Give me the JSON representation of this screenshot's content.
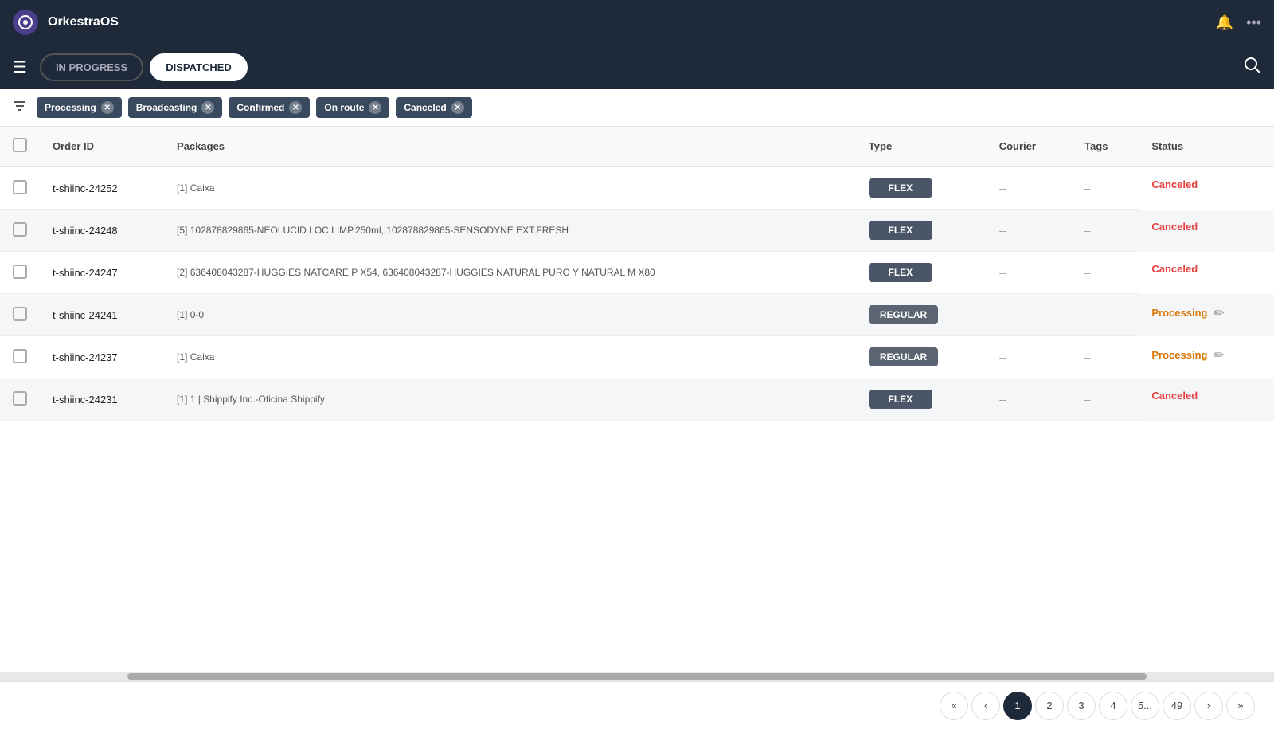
{
  "app": {
    "title": "OrkestraOS",
    "logo_letter": "O"
  },
  "header": {
    "bell_icon": "🔔",
    "more_icon": "···"
  },
  "toolbar": {
    "tab_in_progress": "IN PROGRESS",
    "tab_dispatched": "DISPATCHED",
    "active_tab": "dispatched"
  },
  "filters": {
    "items": [
      {
        "label": "Processing"
      },
      {
        "label": "Broadcasting"
      },
      {
        "label": "Confirmed"
      },
      {
        "label": "On route"
      },
      {
        "label": "Canceled"
      }
    ]
  },
  "table": {
    "columns": [
      "Order ID",
      "Packages",
      "Type",
      "Courier",
      "Tags",
      "Status"
    ],
    "rows": [
      {
        "id": "t-shiinc-24252",
        "packages": "[1] Caixa",
        "type": "FLEX",
        "type_class": "flex",
        "courier": "--",
        "tags": "–",
        "status": "Canceled",
        "status_class": "canceled"
      },
      {
        "id": "t-shiinc-24248",
        "packages": "[5] 102878829865-NEOLUCID LOC.LIMP.250ml, 102878829865-SENSODYNE EXT.FRESH",
        "type": "FLEX",
        "type_class": "flex",
        "courier": "--",
        "tags": "–",
        "status": "Canceled",
        "status_class": "canceled"
      },
      {
        "id": "t-shiinc-24247",
        "packages": "[2] 636408043287-HUGGIES NATCARE P X54, 636408043287-HUGGIES NATURAL PURO Y NATURAL M X80",
        "type": "FLEX",
        "type_class": "flex",
        "courier": "--",
        "tags": "–",
        "status": "Canceled",
        "status_class": "canceled"
      },
      {
        "id": "t-shiinc-24241",
        "packages": "[1] 0-0",
        "type": "REGULAR",
        "type_class": "regular",
        "courier": "--",
        "tags": "–",
        "status": "Processing",
        "status_class": "processing"
      },
      {
        "id": "t-shiinc-24237",
        "packages": "[1] Caixa",
        "type": "REGULAR",
        "type_class": "regular",
        "courier": "--",
        "tags": "–",
        "status": "Processing",
        "status_class": "processing"
      },
      {
        "id": "t-shiinc-24231",
        "packages": "[1] 1 | Shippify Inc.-Oficina Shippify",
        "type": "FLEX",
        "type_class": "flex",
        "courier": "--",
        "tags": "–",
        "status": "Canceled",
        "status_class": "canceled"
      }
    ]
  },
  "pagination": {
    "pages": [
      "1",
      "2",
      "3",
      "4",
      "5...",
      "49"
    ],
    "current": "1"
  }
}
